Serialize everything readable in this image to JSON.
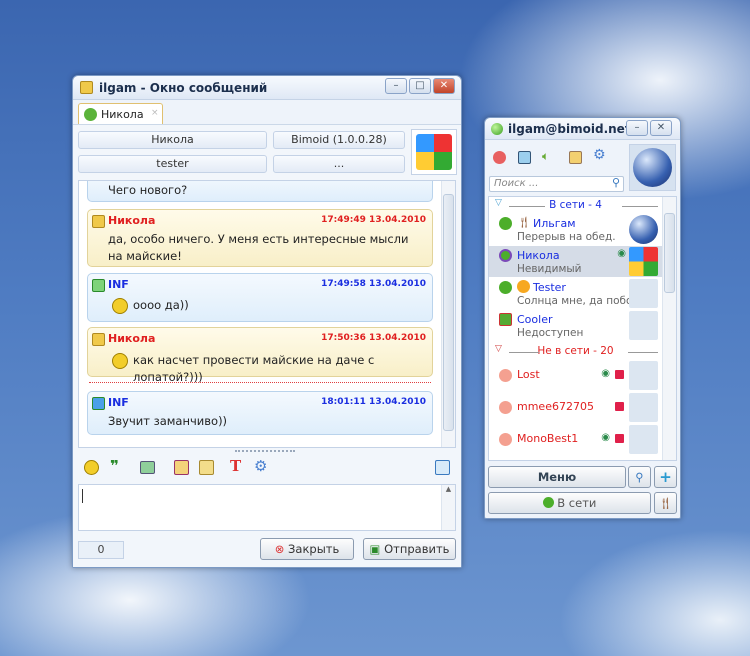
{
  "chat_window": {
    "title": "ilgam - Окно сообщений",
    "tab": {
      "label": "Никола",
      "close": "×"
    },
    "info": {
      "nick": "Никола",
      "client": "Bimoid (1.0.0.28)",
      "account": "tester",
      "more": "..."
    },
    "messages": [
      {
        "type": "out",
        "author": "",
        "time": "",
        "text": "Чего нового?"
      },
      {
        "type": "in",
        "author": "Никола",
        "time": "17:49:49 13.04.2010",
        "text": "да, особо ничего. У меня есть интересные мысли на майские!"
      },
      {
        "type": "out",
        "author": "INF",
        "time": "17:49:58 13.04.2010",
        "text": "оооо да))",
        "smiley": true
      },
      {
        "type": "in",
        "author": "Никола",
        "time": "17:50:36 13.04.2010",
        "text": "как насчет провести майские на даче с лопатой?)))",
        "smiley": true
      },
      {
        "type": "out",
        "author": "INF",
        "time": "18:01:11 13.04.2010",
        "text": "Звучит заманчиво))"
      }
    ],
    "toolbar": [
      "smiley-icon",
      "quote-icon",
      "history-icon",
      "edit-icon",
      "file-icon",
      "font-icon",
      "settings-icon",
      "layout-icon"
    ],
    "input": {
      "value": ""
    },
    "counter": "0",
    "close_label": "Закрыть",
    "send_label": "Отправить"
  },
  "contact_window": {
    "title": "ilgam@bimoid.net",
    "search_placeholder": "Поиск ...",
    "groups": [
      {
        "label": "В сети - 4",
        "color": "#1a2ee0",
        "contacts": [
          {
            "name": "Ильгам",
            "status": "Перерыв на обед."
          },
          {
            "name": "Никола",
            "status": "Невидимый",
            "selected": true
          },
          {
            "name": "Tester",
            "status": "Солнца мне, да побо..."
          },
          {
            "name": "Cooler",
            "status": "Недоступен"
          }
        ]
      },
      {
        "label": "Не в сети - 20",
        "color": "#e02020",
        "contacts": [
          {
            "name": "Lost"
          },
          {
            "name": "mmee672705"
          },
          {
            "name": "MonoBest1"
          }
        ]
      }
    ],
    "menu_label": "Меню",
    "status_label": "В сети",
    "colors": {
      "online": "#1a2ee0",
      "offline": "#e02020",
      "time_in": "#e02020",
      "time_out": "#1a2ee0"
    }
  }
}
